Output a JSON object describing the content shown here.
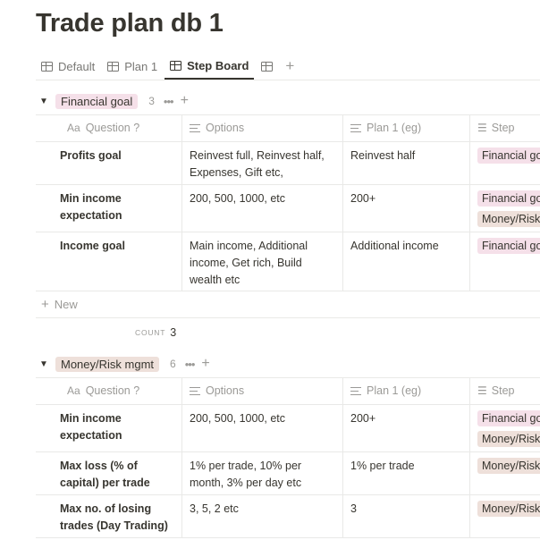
{
  "page": {
    "title": "Trade plan db 1"
  },
  "colors": {
    "pink_tag": "#f5e0e9",
    "brown_tag": "#eee0da",
    "text": "#37352f",
    "muted": "#9b9a97"
  },
  "tabs": [
    {
      "label": "Default",
      "icon": "table-icon",
      "active": false
    },
    {
      "label": "Plan 1",
      "icon": "table-icon",
      "active": false
    },
    {
      "label": "Step Board",
      "icon": "table-icon",
      "active": true
    }
  ],
  "columns": {
    "question": "Question ?",
    "question_icon": "Aa",
    "options": "Options",
    "plan": "Plan 1 (eg)",
    "step": "Step"
  },
  "groups": [
    {
      "name": "Financial goal",
      "count": "3",
      "more": "•••",
      "add": "+",
      "rows": [
        {
          "question": "Profits goal",
          "options": "Reinvest full, Reinvest half, Expenses, Gift etc,",
          "plan": "Reinvest half",
          "steps": [
            "Financial goal"
          ]
        },
        {
          "question": "Min income expectation",
          "options": "200, 500, 1000, etc",
          "plan": "200+",
          "steps": [
            "Financial goal",
            "Money/Risk mgmt"
          ]
        },
        {
          "question": "Income goal",
          "options": "Main income, Additional income, Get rich, Build wealth etc",
          "plan": "Additional income",
          "steps": [
            "Financial goal"
          ]
        }
      ],
      "new_label": "New",
      "count_label": "COUNT",
      "count_value": "3"
    },
    {
      "name": "Money/Risk mgmt",
      "count": "6",
      "more": "•••",
      "add": "+",
      "rows": [
        {
          "question": "Min income expectation",
          "options": "200, 500, 1000, etc",
          "plan": "200+",
          "steps": [
            "Financial goal",
            "Money/Risk mgmt"
          ]
        },
        {
          "question": "Max loss (% of capital) per trade",
          "options": "1% per trade, 10% per month, 3% per day etc",
          "plan": "1% per trade",
          "steps": [
            "Money/Risk mgmt"
          ]
        },
        {
          "question": "Max no. of losing trades (Day Trading)",
          "options": "3, 5, 2 etc",
          "plan": "3",
          "steps": [
            "Money/Risk mgmt"
          ]
        }
      ]
    }
  ]
}
